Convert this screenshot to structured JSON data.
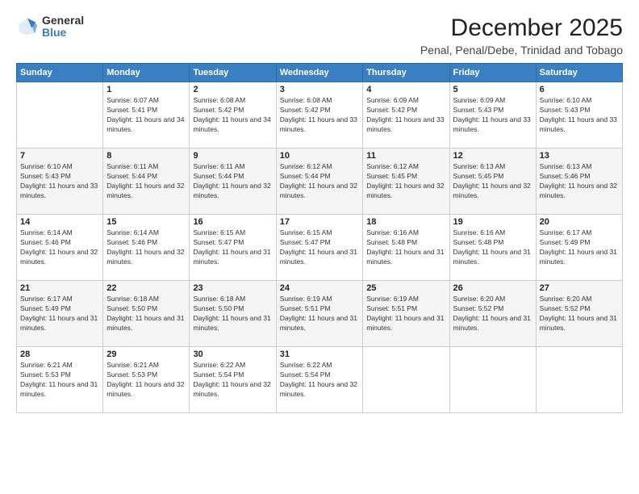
{
  "logo": {
    "general": "General",
    "blue": "Blue"
  },
  "header": {
    "title": "December 2025",
    "subtitle": "Penal, Penal/Debe, Trinidad and Tobago"
  },
  "calendar": {
    "days_of_week": [
      "Sunday",
      "Monday",
      "Tuesday",
      "Wednesday",
      "Thursday",
      "Friday",
      "Saturday"
    ],
    "weeks": [
      [
        {
          "day": "",
          "sunrise": "",
          "sunset": "",
          "daylight": ""
        },
        {
          "day": "1",
          "sunrise": "Sunrise: 6:07 AM",
          "sunset": "Sunset: 5:41 PM",
          "daylight": "Daylight: 11 hours and 34 minutes."
        },
        {
          "day": "2",
          "sunrise": "Sunrise: 6:08 AM",
          "sunset": "Sunset: 5:42 PM",
          "daylight": "Daylight: 11 hours and 34 minutes."
        },
        {
          "day": "3",
          "sunrise": "Sunrise: 6:08 AM",
          "sunset": "Sunset: 5:42 PM",
          "daylight": "Daylight: 11 hours and 33 minutes."
        },
        {
          "day": "4",
          "sunrise": "Sunrise: 6:09 AM",
          "sunset": "Sunset: 5:42 PM",
          "daylight": "Daylight: 11 hours and 33 minutes."
        },
        {
          "day": "5",
          "sunrise": "Sunrise: 6:09 AM",
          "sunset": "Sunset: 5:43 PM",
          "daylight": "Daylight: 11 hours and 33 minutes."
        },
        {
          "day": "6",
          "sunrise": "Sunrise: 6:10 AM",
          "sunset": "Sunset: 5:43 PM",
          "daylight": "Daylight: 11 hours and 33 minutes."
        }
      ],
      [
        {
          "day": "7",
          "sunrise": "Sunrise: 6:10 AM",
          "sunset": "Sunset: 5:43 PM",
          "daylight": "Daylight: 11 hours and 33 minutes."
        },
        {
          "day": "8",
          "sunrise": "Sunrise: 6:11 AM",
          "sunset": "Sunset: 5:44 PM",
          "daylight": "Daylight: 11 hours and 32 minutes."
        },
        {
          "day": "9",
          "sunrise": "Sunrise: 6:11 AM",
          "sunset": "Sunset: 5:44 PM",
          "daylight": "Daylight: 11 hours and 32 minutes."
        },
        {
          "day": "10",
          "sunrise": "Sunrise: 6:12 AM",
          "sunset": "Sunset: 5:44 PM",
          "daylight": "Daylight: 11 hours and 32 minutes."
        },
        {
          "day": "11",
          "sunrise": "Sunrise: 6:12 AM",
          "sunset": "Sunset: 5:45 PM",
          "daylight": "Daylight: 11 hours and 32 minutes."
        },
        {
          "day": "12",
          "sunrise": "Sunrise: 6:13 AM",
          "sunset": "Sunset: 5:45 PM",
          "daylight": "Daylight: 11 hours and 32 minutes."
        },
        {
          "day": "13",
          "sunrise": "Sunrise: 6:13 AM",
          "sunset": "Sunset: 5:46 PM",
          "daylight": "Daylight: 11 hours and 32 minutes."
        }
      ],
      [
        {
          "day": "14",
          "sunrise": "Sunrise: 6:14 AM",
          "sunset": "Sunset: 5:46 PM",
          "daylight": "Daylight: 11 hours and 32 minutes."
        },
        {
          "day": "15",
          "sunrise": "Sunrise: 6:14 AM",
          "sunset": "Sunset: 5:46 PM",
          "daylight": "Daylight: 11 hours and 32 minutes."
        },
        {
          "day": "16",
          "sunrise": "Sunrise: 6:15 AM",
          "sunset": "Sunset: 5:47 PM",
          "daylight": "Daylight: 11 hours and 31 minutes."
        },
        {
          "day": "17",
          "sunrise": "Sunrise: 6:15 AM",
          "sunset": "Sunset: 5:47 PM",
          "daylight": "Daylight: 11 hours and 31 minutes."
        },
        {
          "day": "18",
          "sunrise": "Sunrise: 6:16 AM",
          "sunset": "Sunset: 5:48 PM",
          "daylight": "Daylight: 11 hours and 31 minutes."
        },
        {
          "day": "19",
          "sunrise": "Sunrise: 6:16 AM",
          "sunset": "Sunset: 5:48 PM",
          "daylight": "Daylight: 11 hours and 31 minutes."
        },
        {
          "day": "20",
          "sunrise": "Sunrise: 6:17 AM",
          "sunset": "Sunset: 5:49 PM",
          "daylight": "Daylight: 11 hours and 31 minutes."
        }
      ],
      [
        {
          "day": "21",
          "sunrise": "Sunrise: 6:17 AM",
          "sunset": "Sunset: 5:49 PM",
          "daylight": "Daylight: 11 hours and 31 minutes."
        },
        {
          "day": "22",
          "sunrise": "Sunrise: 6:18 AM",
          "sunset": "Sunset: 5:50 PM",
          "daylight": "Daylight: 11 hours and 31 minutes."
        },
        {
          "day": "23",
          "sunrise": "Sunrise: 6:18 AM",
          "sunset": "Sunset: 5:50 PM",
          "daylight": "Daylight: 11 hours and 31 minutes."
        },
        {
          "day": "24",
          "sunrise": "Sunrise: 6:19 AM",
          "sunset": "Sunset: 5:51 PM",
          "daylight": "Daylight: 11 hours and 31 minutes."
        },
        {
          "day": "25",
          "sunrise": "Sunrise: 6:19 AM",
          "sunset": "Sunset: 5:51 PM",
          "daylight": "Daylight: 11 hours and 31 minutes."
        },
        {
          "day": "26",
          "sunrise": "Sunrise: 6:20 AM",
          "sunset": "Sunset: 5:52 PM",
          "daylight": "Daylight: 11 hours and 31 minutes."
        },
        {
          "day": "27",
          "sunrise": "Sunrise: 6:20 AM",
          "sunset": "Sunset: 5:52 PM",
          "daylight": "Daylight: 11 hours and 31 minutes."
        }
      ],
      [
        {
          "day": "28",
          "sunrise": "Sunrise: 6:21 AM",
          "sunset": "Sunset: 5:53 PM",
          "daylight": "Daylight: 11 hours and 31 minutes."
        },
        {
          "day": "29",
          "sunrise": "Sunrise: 6:21 AM",
          "sunset": "Sunset: 5:53 PM",
          "daylight": "Daylight: 11 hours and 32 minutes."
        },
        {
          "day": "30",
          "sunrise": "Sunrise: 6:22 AM",
          "sunset": "Sunset: 5:54 PM",
          "daylight": "Daylight: 11 hours and 32 minutes."
        },
        {
          "day": "31",
          "sunrise": "Sunrise: 6:22 AM",
          "sunset": "Sunset: 5:54 PM",
          "daylight": "Daylight: 11 hours and 32 minutes."
        },
        {
          "day": "",
          "sunrise": "",
          "sunset": "",
          "daylight": ""
        },
        {
          "day": "",
          "sunrise": "",
          "sunset": "",
          "daylight": ""
        },
        {
          "day": "",
          "sunrise": "",
          "sunset": "",
          "daylight": ""
        }
      ]
    ]
  }
}
